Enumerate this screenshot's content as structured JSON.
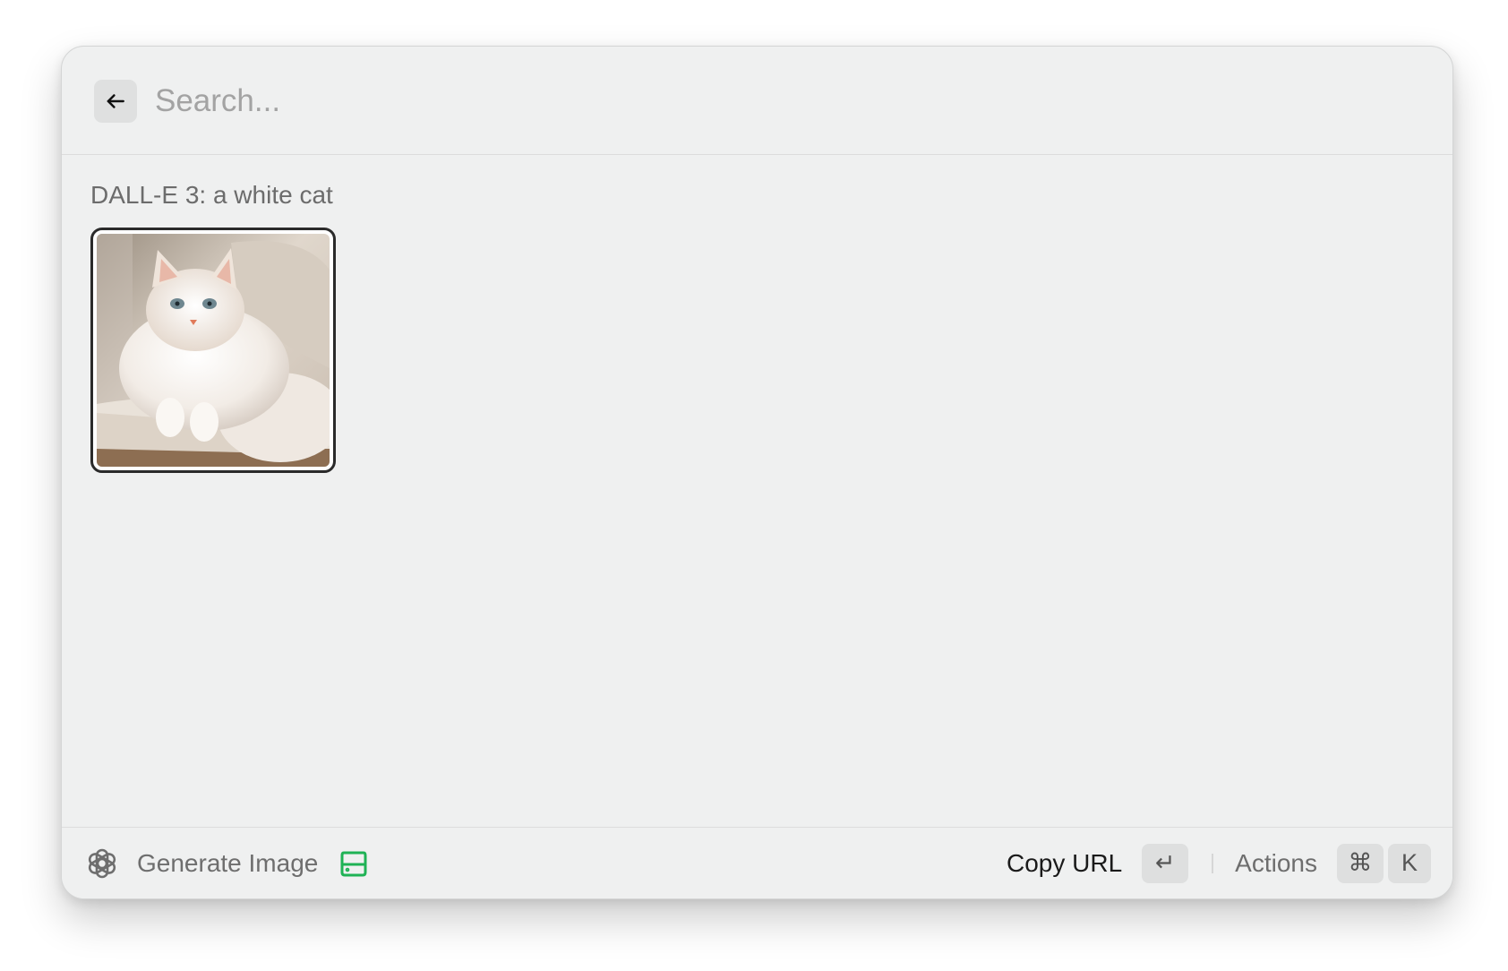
{
  "search": {
    "placeholder": "Search...",
    "value": ""
  },
  "back_button": {
    "icon": "arrow-left-icon"
  },
  "section": {
    "title": "DALL-E 3: a white cat"
  },
  "images": [
    {
      "subject": "white fluffy cat on a cushion",
      "selected": true
    }
  ],
  "footer": {
    "title": "Generate Image",
    "logo_icon": "openai-logo-icon",
    "status_icon": "hard-drive-icon",
    "status_icon_color": "#1fb255",
    "primary_action": "Copy URL",
    "primary_shortcut": "↵",
    "actions_label": "Actions",
    "actions_shortcut": [
      "⌘",
      "K"
    ]
  }
}
